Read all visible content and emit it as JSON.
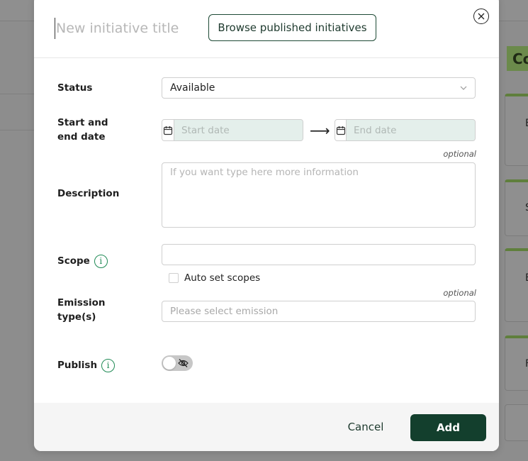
{
  "background": {
    "chip_text": "Co",
    "card_letters": [
      "E",
      "S",
      "E",
      "F"
    ]
  },
  "modal": {
    "title_placeholder": "New initiative title",
    "browse_button": "Browse published initiatives",
    "close_icon": "close-circle-icon"
  },
  "form": {
    "status": {
      "label": "Status",
      "value": "Available"
    },
    "dates": {
      "label_line1": "Start and",
      "label_line2": "end date",
      "start_placeholder": "Start date",
      "end_placeholder": "End date",
      "arrow": "⟶"
    },
    "description": {
      "label": "Description",
      "optional": "optional",
      "placeholder": "If you want type here more information"
    },
    "scope": {
      "label": "Scope",
      "info": "i",
      "value": "",
      "auto_label": "Auto set scopes"
    },
    "emission": {
      "label_line1": "Emission",
      "label_line2": "type(s)",
      "optional": "optional",
      "placeholder": "Please select emission"
    },
    "publish": {
      "label": "Publish",
      "info": "i"
    }
  },
  "footer": {
    "cancel": "Cancel",
    "add": "Add"
  },
  "colors": {
    "primary": "#133f2d",
    "info": "#1f8a55",
    "date_fill": "#e4efeb"
  }
}
